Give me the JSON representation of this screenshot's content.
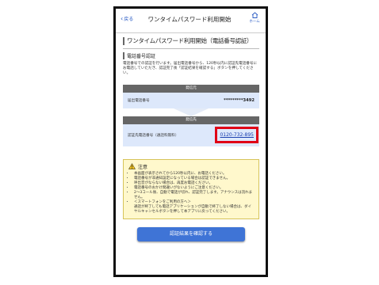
{
  "header": {
    "back_label": "戻る",
    "title": "ワンタイムパスワード利用開始",
    "home_label": "ホーム"
  },
  "page": {
    "heading": "ワンタイムパスワード利用開始（電話番号認証）",
    "section_title": "電話番号認証",
    "description": "電話番号での認証を行います。届出電話番号から、120秒以内に認証先電話番号にお電話していただき、認証完了後「認証結果を確認する」ボタンを押してください。"
  },
  "sender_box": {
    "header": "発信元",
    "label": "届出電話番号",
    "value": "*********3492"
  },
  "receiver_box": {
    "header": "発信先",
    "label": "認証先電話番号（通話料無料）",
    "value": "0120-732-895"
  },
  "caution": {
    "title": "注意",
    "items": [
      "本画面が表示されてから120秒以内に、お電話ください。",
      "電話番号が非通知設定になっている場合は認証できません。",
      "呼出音がならない場合は、再度お電話ください。",
      "電話番号のおかけ間違いがないようにご注意ください。",
      "2〜3コール後、自動で電話が切れ、認証完了します。アナウンスは流れません。",
      "＜スマートフォンをご利用の方へ＞"
    ],
    "sub_note": "通話が終了しても電話アプリケーションが自動で終了しない場合は、ダイヤルキャンセルボタンを押して本アプリに戻ってください。"
  },
  "cta": {
    "label": "認証結果を確認する"
  },
  "colors": {
    "accent": "#3f74d6",
    "highlight_border": "#e00016",
    "box_header": "#666666",
    "box_row": "#dde8fb",
    "caution_bg": "#fff8cc"
  }
}
